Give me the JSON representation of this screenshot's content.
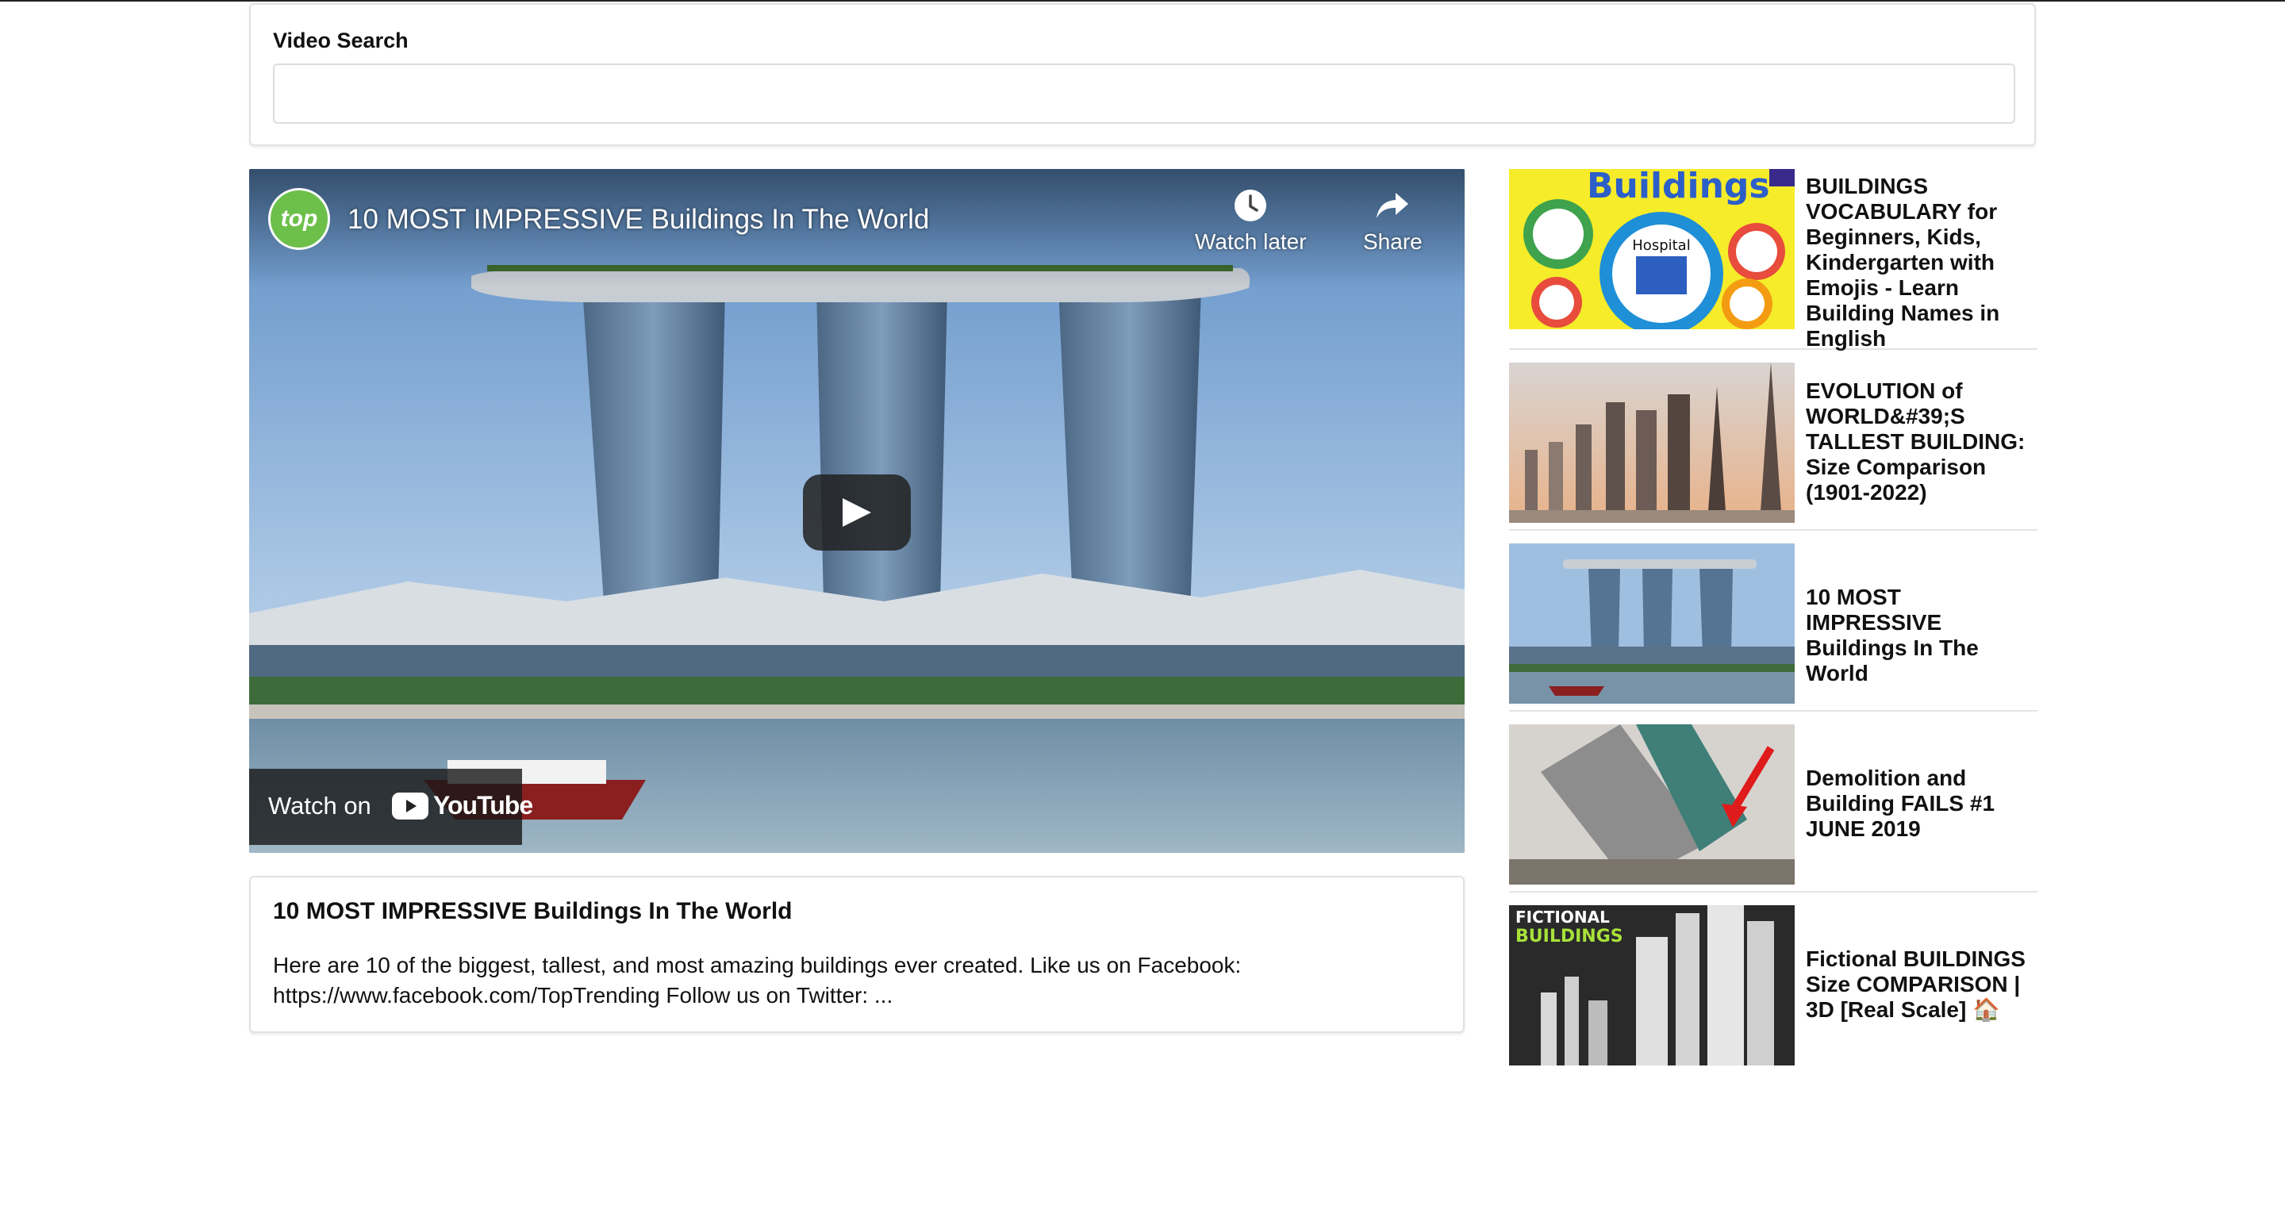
{
  "search": {
    "label": "Video Search",
    "value": "",
    "placeholder": ""
  },
  "player": {
    "channel_logo_text": "top",
    "title": "10 MOST IMPRESSIVE Buildings In The World",
    "watch_later_label": "Watch later",
    "share_label": "Share",
    "watch_on_label": "Watch on",
    "youtube_label": "YouTube",
    "icons": [
      "clock-icon",
      "share-arrow-icon",
      "play-icon",
      "youtube-logo-icon"
    ]
  },
  "selected_video": {
    "title": "10 MOST IMPRESSIVE Buildings In The World",
    "description": "Here are 10 of the biggest, tallest, and most amazing buildings ever created. Like us on Facebook: https://www.facebook.com/TopTrending Follow us on Twitter: ..."
  },
  "video_list": [
    {
      "title": "BUILDINGS VOCABULARY for Beginners, Kids, Kindergarten with Emojis - Learn Building Names in English",
      "thumb_text": "Buildings",
      "thumb_sub": "Hospital"
    },
    {
      "title": "EVOLUTION of WORLD&#39;S TALLEST BUILDING: Size Comparison (1901-2022)"
    },
    {
      "title": "10 MOST IMPRESSIVE Buildings In The World"
    },
    {
      "title": "Demolition and Building FAILS #1 JUNE 2019"
    },
    {
      "title": "Fictional BUILDINGS Size COMPARISON | 3D [Real Scale] 🏠",
      "thumb_text": "FICTIONAL",
      "thumb_sub": "BUILDINGS"
    }
  ],
  "colors": {
    "accent_text": "#111111",
    "border": "#e1e1e1",
    "channel_logo": "#6cc04a"
  }
}
